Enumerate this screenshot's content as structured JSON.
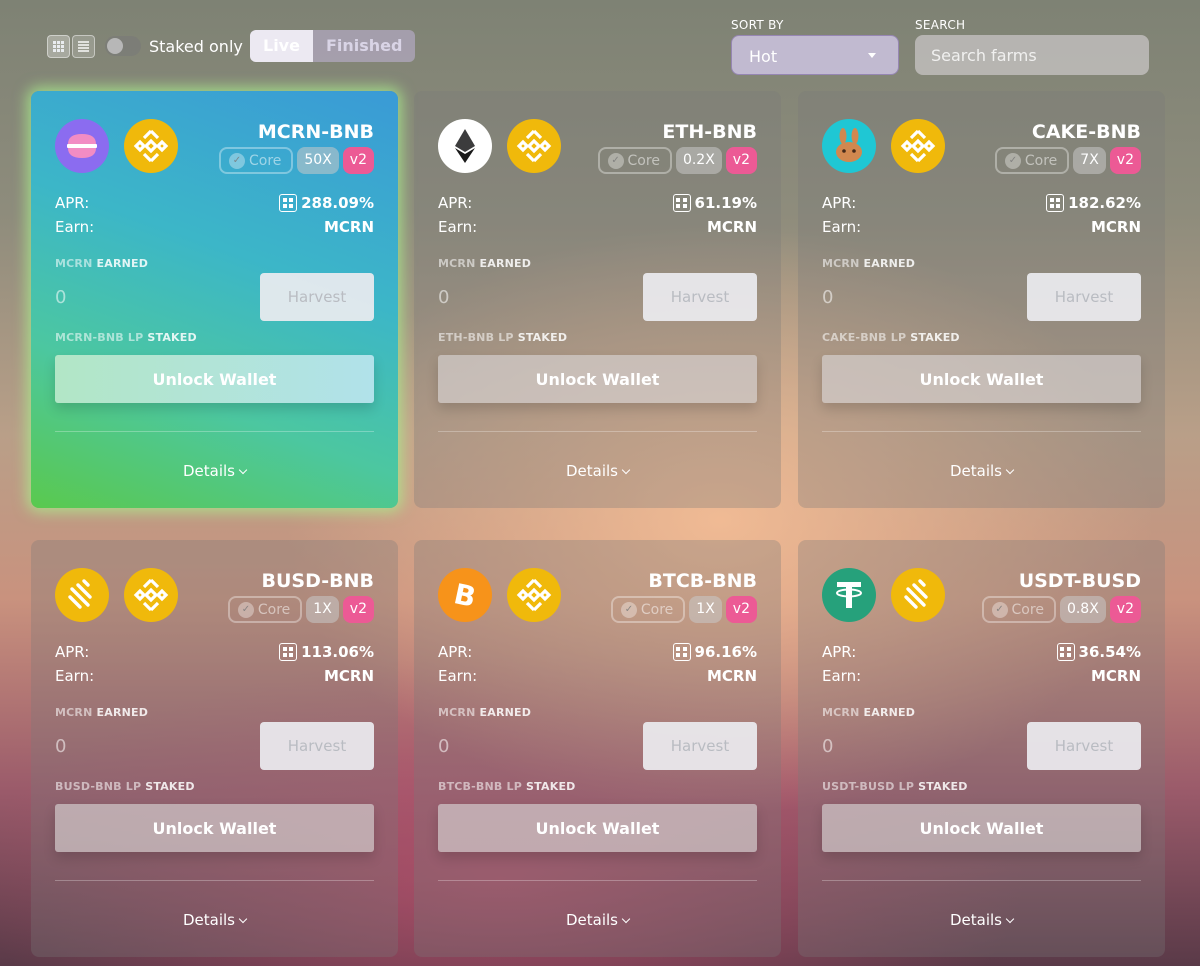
{
  "toolbar": {
    "staked_only_label": "Staked only",
    "tabs": [
      "Live",
      "Finished"
    ],
    "sort_label": "SORT BY",
    "sort_value": "Hot",
    "search_label": "SEARCH",
    "search_placeholder": "Search farms"
  },
  "colors": {
    "v2_badge": "#ec5a95",
    "highlight_card": "#3cb6c8",
    "bnb": "#f0b90b"
  },
  "farms": [
    {
      "name": "MCRN-BNB",
      "token_icon": "macaron-icon",
      "quote_icon": "bnb-icon",
      "core_label": "Core",
      "multiplier": "50X",
      "version": "v2",
      "apr_label": "APR:",
      "apr": "288.09%",
      "earn_label": "Earn:",
      "earn": "MCRN",
      "earned_token": "MCRN",
      "earned_suffix": "EARNED",
      "earned_value": "0",
      "harvest_label": "Harvest",
      "staked_token": "MCRN-BNB LP",
      "staked_suffix": "STAKED",
      "unlock_label": "Unlock Wallet",
      "details_label": "Details"
    },
    {
      "name": "ETH-BNB",
      "token_icon": "eth-icon",
      "quote_icon": "bnb-icon",
      "core_label": "Core",
      "multiplier": "0.2X",
      "version": "v2",
      "apr_label": "APR:",
      "apr": "61.19%",
      "earn_label": "Earn:",
      "earn": "MCRN",
      "earned_token": "MCRN",
      "earned_suffix": "EARNED",
      "earned_value": "0",
      "harvest_label": "Harvest",
      "staked_token": "ETH-BNB LP",
      "staked_suffix": "STAKED",
      "unlock_label": "Unlock Wallet",
      "details_label": "Details"
    },
    {
      "name": "CAKE-BNB",
      "token_icon": "cake-bunny-icon",
      "quote_icon": "bnb-icon",
      "core_label": "Core",
      "multiplier": "7X",
      "version": "v2",
      "apr_label": "APR:",
      "apr": "182.62%",
      "earn_label": "Earn:",
      "earn": "MCRN",
      "earned_token": "MCRN",
      "earned_suffix": "EARNED",
      "earned_value": "0",
      "harvest_label": "Harvest",
      "staked_token": "CAKE-BNB LP",
      "staked_suffix": "STAKED",
      "unlock_label": "Unlock Wallet",
      "details_label": "Details"
    },
    {
      "name": "BUSD-BNB",
      "token_icon": "busd-icon",
      "quote_icon": "bnb-icon",
      "core_label": "Core",
      "multiplier": "1X",
      "version": "v2",
      "apr_label": "APR:",
      "apr": "113.06%",
      "earn_label": "Earn:",
      "earn": "MCRN",
      "earned_token": "MCRN",
      "earned_suffix": "EARNED",
      "earned_value": "0",
      "harvest_label": "Harvest",
      "staked_token": "BUSD-BNB LP",
      "staked_suffix": "STAKED",
      "unlock_label": "Unlock Wallet",
      "details_label": "Details"
    },
    {
      "name": "BTCB-BNB",
      "token_icon": "btc-icon",
      "quote_icon": "bnb-icon",
      "core_label": "Core",
      "multiplier": "1X",
      "version": "v2",
      "apr_label": "APR:",
      "apr": "96.16%",
      "earn_label": "Earn:",
      "earn": "MCRN",
      "earned_token": "MCRN",
      "earned_suffix": "EARNED",
      "earned_value": "0",
      "harvest_label": "Harvest",
      "staked_token": "BTCB-BNB LP",
      "staked_suffix": "STAKED",
      "unlock_label": "Unlock Wallet",
      "details_label": "Details"
    },
    {
      "name": "USDT-BUSD",
      "token_icon": "tether-icon",
      "quote_icon": "busd-icon",
      "core_label": "Core",
      "multiplier": "0.8X",
      "version": "v2",
      "apr_label": "APR:",
      "apr": "36.54%",
      "earn_label": "Earn:",
      "earn": "MCRN",
      "earned_token": "MCRN",
      "earned_suffix": "EARNED",
      "earned_value": "0",
      "harvest_label": "Harvest",
      "staked_token": "USDT-BUSD LP",
      "staked_suffix": "STAKED",
      "unlock_label": "Unlock Wallet",
      "details_label": "Details"
    }
  ]
}
